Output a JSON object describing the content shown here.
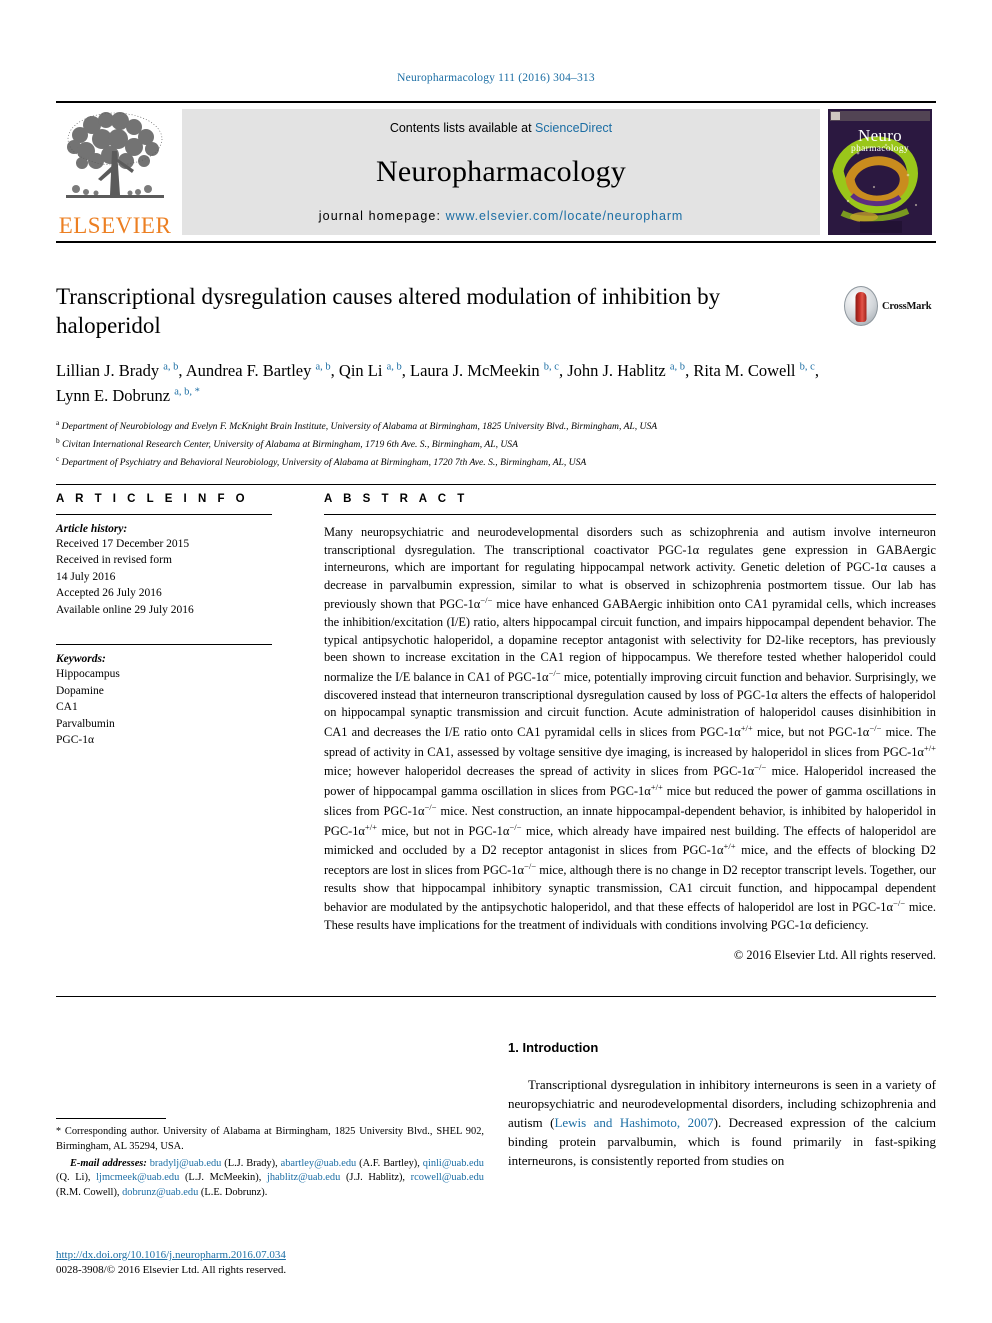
{
  "running_head": "Neuropharmacology 111 (2016) 304–313",
  "masthead": {
    "publisher_logo_text": "ELSEVIER",
    "contents_prefix": "Contents lists available at ",
    "contents_link": "ScienceDirect",
    "journal_name": "Neuropharmacology",
    "homepage_prefix": "journal homepage: ",
    "homepage_url": "www.elsevier.com/locate/neuropharm",
    "cover_title_line1": "Neuro",
    "cover_title_line2": "pharmacology"
  },
  "article": {
    "title": "Transcriptional dysregulation causes altered modulation of inhibition by haloperidol",
    "crossmark_label": "CrossMark",
    "authors": [
      {
        "name": "Lillian J. Brady",
        "marks": "a, b",
        "sep": ", "
      },
      {
        "name": "Aundrea F. Bartley",
        "marks": "a, b",
        "sep": ", "
      },
      {
        "name": "Qin Li",
        "marks": "a, b",
        "sep": ", "
      },
      {
        "name": "Laura J. McMeekin",
        "marks": "b, c",
        "sep": ", "
      },
      {
        "name": "John J. Hablitz",
        "marks": "a, b",
        "sep": ", "
      },
      {
        "name": "Rita M. Cowell",
        "marks": "b, c",
        "sep": ", "
      },
      {
        "name": "Lynn E. Dobrunz",
        "marks": "a, b, *",
        "sep": ""
      }
    ],
    "affiliations": [
      {
        "mark": "a",
        "text": "Department of Neurobiology and Evelyn F. McKnight Brain Institute, University of Alabama at Birmingham, 1825 University Blvd., Birmingham, AL, USA"
      },
      {
        "mark": "b",
        "text": "Civitan International Research Center, University of Alabama at Birmingham, 1719 6th Ave. S., Birmingham, AL, USA"
      },
      {
        "mark": "c",
        "text": "Department of Psychiatry and Behavioral Neurobiology, University of Alabama at Birmingham, 1720 7th Ave. S., Birmingham, AL, USA"
      }
    ]
  },
  "article_info": {
    "heading": "A R T I C L E    I N F O",
    "history_label": "Article history:",
    "history": [
      "Received 17 December 2015",
      "Received in revised form",
      "14 July 2016",
      "Accepted 26 July 2016",
      "Available online 29 July 2016"
    ],
    "keywords_label": "Keywords:",
    "keywords": [
      "Hippocampus",
      "Dopamine",
      "CA1",
      "Parvalbumin",
      "PGC-1α"
    ]
  },
  "abstract": {
    "heading": "A B S T R A C T",
    "paragraph_1": "Many neuropsychiatric and neurodevelopmental disorders such as schizophrenia and autism involve interneuron transcriptional dysregulation. The transcriptional coactivator PGC-1α regulates gene expression in GABAergic interneurons, which are important for regulating hippocampal network activity. Genetic deletion of PGC-1α causes a decrease in parvalbumin expression, similar to what is observed in schizophrenia postmortem tissue. Our lab has previously shown that PGC-1α",
    "sup_1": "−/−",
    "paragraph_2": " mice have enhanced GABAergic inhibition onto CA1 pyramidal cells, which increases the inhibition/excitation (I/E) ratio, alters hippocampal circuit function, and impairs hippocampal dependent behavior. The typical antipsychotic haloperidol, a dopamine receptor antagonist with selectivity for D2-like receptors, has previously been shown to increase excitation in the CA1 region of hippocampus. We therefore tested whether haloperidol could normalize the I/E balance in CA1 of PGC-1α",
    "sup_2": "−/−",
    "paragraph_3": " mice, potentially improving circuit function and behavior. Surprisingly, we discovered instead that interneuron transcriptional dysregulation caused by loss of PGC-1α alters the effects of haloperidol on hippocampal synaptic transmission and circuit function. Acute administration of haloperidol causes disinhibition in CA1 and decreases the I/E ratio onto CA1 pyramidal cells in slices from PGC-1α",
    "sup_3": "+/+",
    "paragraph_4": " mice, but not PGC-1α",
    "sup_4": "−/−",
    "paragraph_5": " mice. The spread of activity in CA1, assessed by voltage sensitive dye imaging, is increased by haloperidol in slices from PGC-1α",
    "sup_5": "+/+",
    "paragraph_6": " mice; however haloperidol decreases the spread of activity in slices from PGC-1α",
    "sup_6": "−/−",
    "paragraph_7": " mice. Haloperidol increased the power of hippocampal gamma oscillation in slices from PGC-1α",
    "sup_7": "+/+",
    "paragraph_8": " mice but reduced the power of gamma oscillations in slices from PGC-1α",
    "sup_8": "−/−",
    "paragraph_9": " mice. Nest construction, an innate hippocampal-dependent behavior, is inhibited by haloperidol in PGC-1α",
    "sup_9": "+/+",
    "paragraph_10": " mice, but not in PGC-1α",
    "sup_10": "−/−",
    "paragraph_11": " mice, which already have impaired nest building. The effects of haloperidol are mimicked and occluded by a D2 receptor antagonist in slices from PGC-1α",
    "sup_11": "+/+",
    "paragraph_12": " mice, and the effects of blocking D2 receptors are lost in slices from PGC-1α",
    "sup_12": "−/−",
    "paragraph_13": " mice, although there is no change in D2 receptor transcript levels. Together, our results show that hippocampal inhibitory synaptic transmission, CA1 circuit function, and hippocampal dependent behavior are modulated by the antipsychotic haloperidol, and that these effects of haloperidol are lost in PGC-1α",
    "sup_13": "−/−",
    "paragraph_14": " mice. These results have implications for the treatment of individuals with conditions involving PGC-1α deficiency.",
    "copyright": "© 2016 Elsevier Ltd. All rights reserved."
  },
  "introduction": {
    "heading": "1.  Introduction",
    "text_1": "Transcriptional dysregulation in inhibitory interneurons is seen in a variety of neuropsychiatric and neurodevelopmental disorders, including schizophrenia and autism (",
    "citation": "Lewis and Hashimoto, 2007",
    "text_2": "). Decreased expression of the calcium binding protein parvalbumin, which is found primarily in fast-spiking interneurons, is consistently reported from studies on"
  },
  "footnotes": {
    "corresponding_star": "*",
    "corresponding_text": " Corresponding author. University of Alabama at Birmingham, 1825 University Blvd., SHEL 902, Birmingham, AL 35294, USA.",
    "email_label": "E-mail addresses:",
    "emails": [
      {
        "address": "bradylj@uab.edu",
        "owner": " (L.J. Brady), "
      },
      {
        "address": "abartley@uab.edu",
        "owner": " (A.F. Bartley), "
      },
      {
        "address": "qinli@uab.edu",
        "owner": " (Q. Li), "
      },
      {
        "address": "ljmcmeek@uab.edu",
        "owner": " (L.J. McMeekin), "
      },
      {
        "address": "jhablitz@uab.edu",
        "owner": " (J.J. Hablitz), "
      },
      {
        "address": "rcowell@uab.edu",
        "owner": " (R.M. Cowell), "
      },
      {
        "address": "dobrunz@uab.edu",
        "owner": " (L.E. Dobrunz)."
      }
    ]
  },
  "footer": {
    "doi": "http://dx.doi.org/10.1016/j.neuropharm.2016.07.034",
    "issn_line": "0028-3908/© 2016 Elsevier Ltd. All rights reserved."
  },
  "colors": {
    "link_blue": "#1c6ea4",
    "elsevier_orange": "#ec7f22",
    "band_gray": "#e3e3e3"
  }
}
